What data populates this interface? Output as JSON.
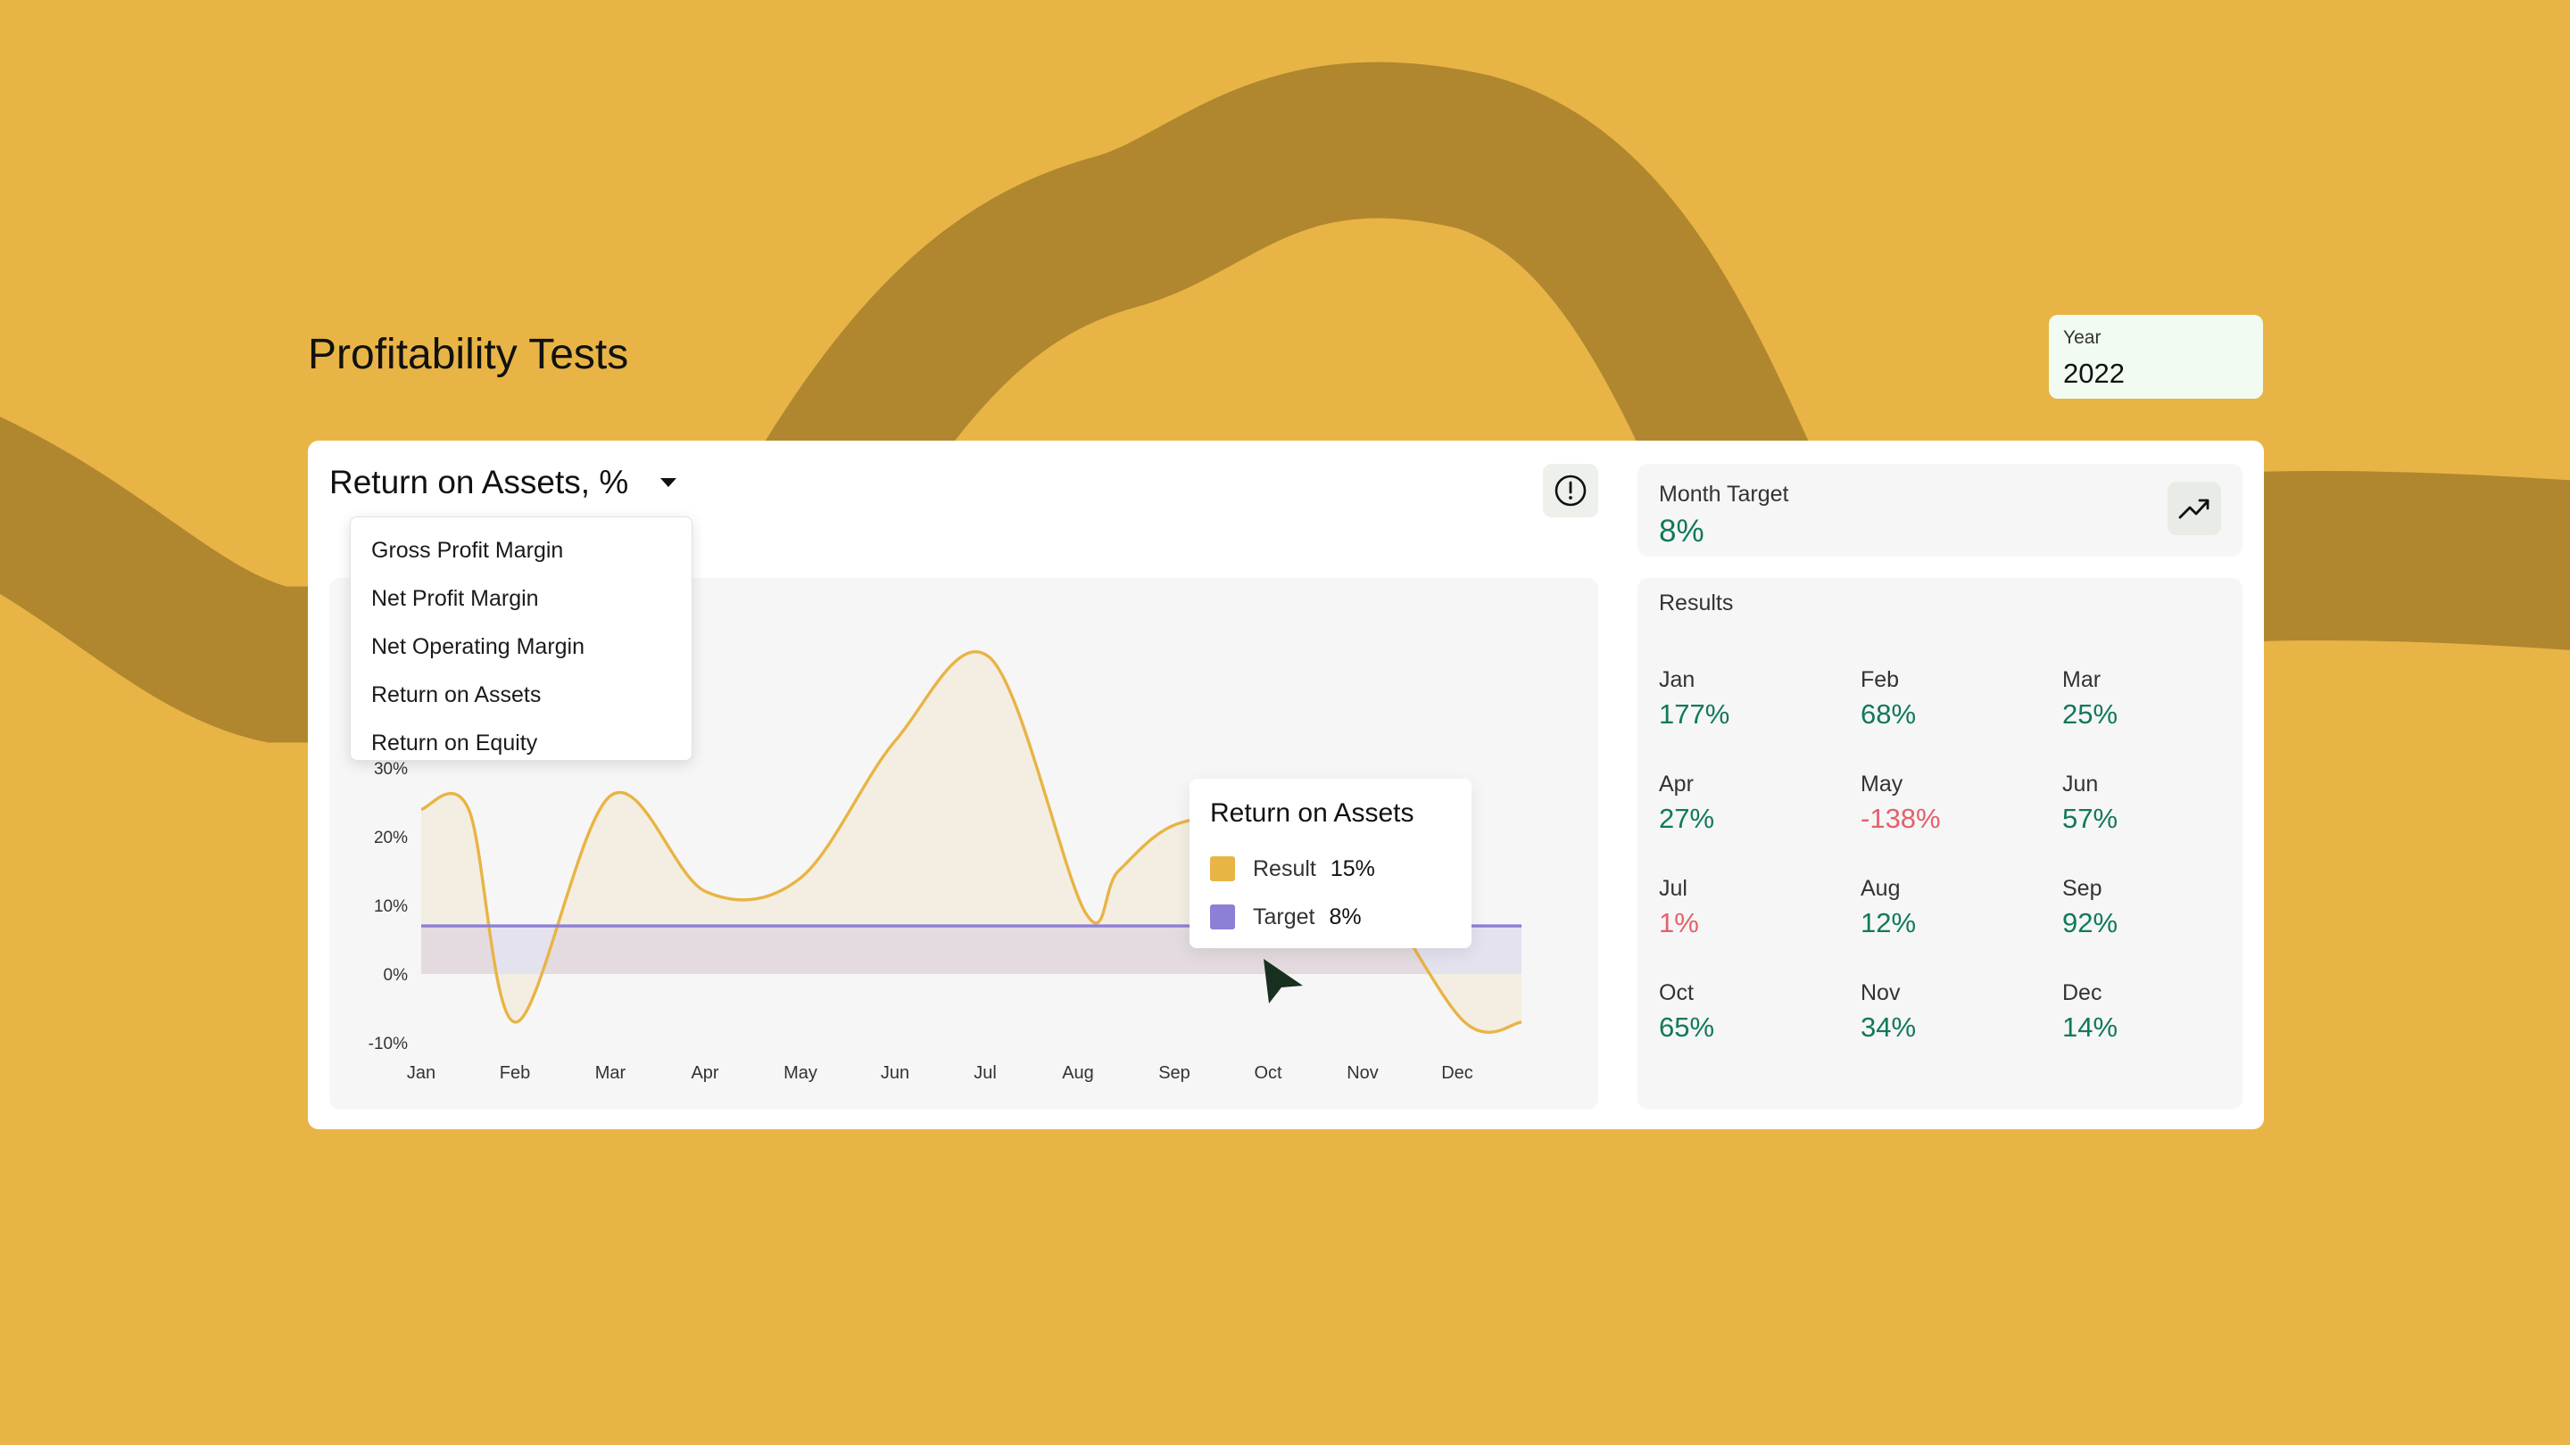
{
  "page": {
    "title": "Profitability Tests"
  },
  "year": {
    "label": "Year",
    "value": "2022"
  },
  "metric_select": {
    "selected": "Return on Assets, %",
    "options": [
      "Gross Profit Margin",
      "Net Profit Margin",
      "Net Operating Margin",
      "Return on Assets",
      "Return on Equity"
    ]
  },
  "tooltip": {
    "title": "Return on Assets",
    "rows": [
      {
        "label": "Result",
        "value": "15%",
        "color": "#E8B445"
      },
      {
        "label": "Target",
        "value": "8%",
        "color": "#8C7FD6"
      }
    ]
  },
  "month_target": {
    "label": "Month Target",
    "value": "8%"
  },
  "results": {
    "label": "Results",
    "items": [
      {
        "month": "Jan",
        "value": "177%",
        "status": "positive"
      },
      {
        "month": "Feb",
        "value": "68%",
        "status": "positive"
      },
      {
        "month": "Mar",
        "value": "25%",
        "status": "positive"
      },
      {
        "month": "Apr",
        "value": "27%",
        "status": "positive"
      },
      {
        "month": "May",
        "value": "-138%",
        "status": "negative"
      },
      {
        "month": "Jun",
        "value": "57%",
        "status": "positive"
      },
      {
        "month": "Jul",
        "value": "1%",
        "status": "negative"
      },
      {
        "month": "Aug",
        "value": "12%",
        "status": "positive"
      },
      {
        "month": "Sep",
        "value": "92%",
        "status": "positive"
      },
      {
        "month": "Oct",
        "value": "65%",
        "status": "positive"
      },
      {
        "month": "Nov",
        "value": "34%",
        "status": "positive"
      },
      {
        "month": "Dec",
        "value": "14%",
        "status": "positive"
      }
    ]
  },
  "colors": {
    "background": "#E8B445",
    "swoosh": "#B0872F",
    "result_line": "#E8B445",
    "target_line": "#8C7FD6",
    "positive": "#11785C",
    "negative": "#E5606A"
  },
  "chart_data": {
    "type": "line",
    "categories": [
      "Jan",
      "Feb",
      "Mar",
      "Apr",
      "May",
      "Jun",
      "Jul",
      "Aug",
      "Sep",
      "Oct",
      "Nov",
      "Dec"
    ],
    "ytick_labels": [
      "-10%",
      "0%",
      "10%",
      "20%",
      "30%"
    ],
    "ylim": [
      -10,
      30
    ],
    "grid": false,
    "series": [
      {
        "name": "Result",
        "x": [
          0,
          0.5,
          1,
          2,
          3,
          4,
          5,
          6,
          7,
          7.35,
          8,
          9,
          10,
          11,
          11.6
        ],
        "values": [
          24,
          24,
          -7,
          26,
          12,
          14,
          34,
          46,
          9,
          15,
          22,
          22,
          13,
          -7,
          -7
        ]
      },
      {
        "name": "Target",
        "x": [
          0,
          11.6
        ],
        "values": [
          7,
          7
        ]
      }
    ]
  }
}
